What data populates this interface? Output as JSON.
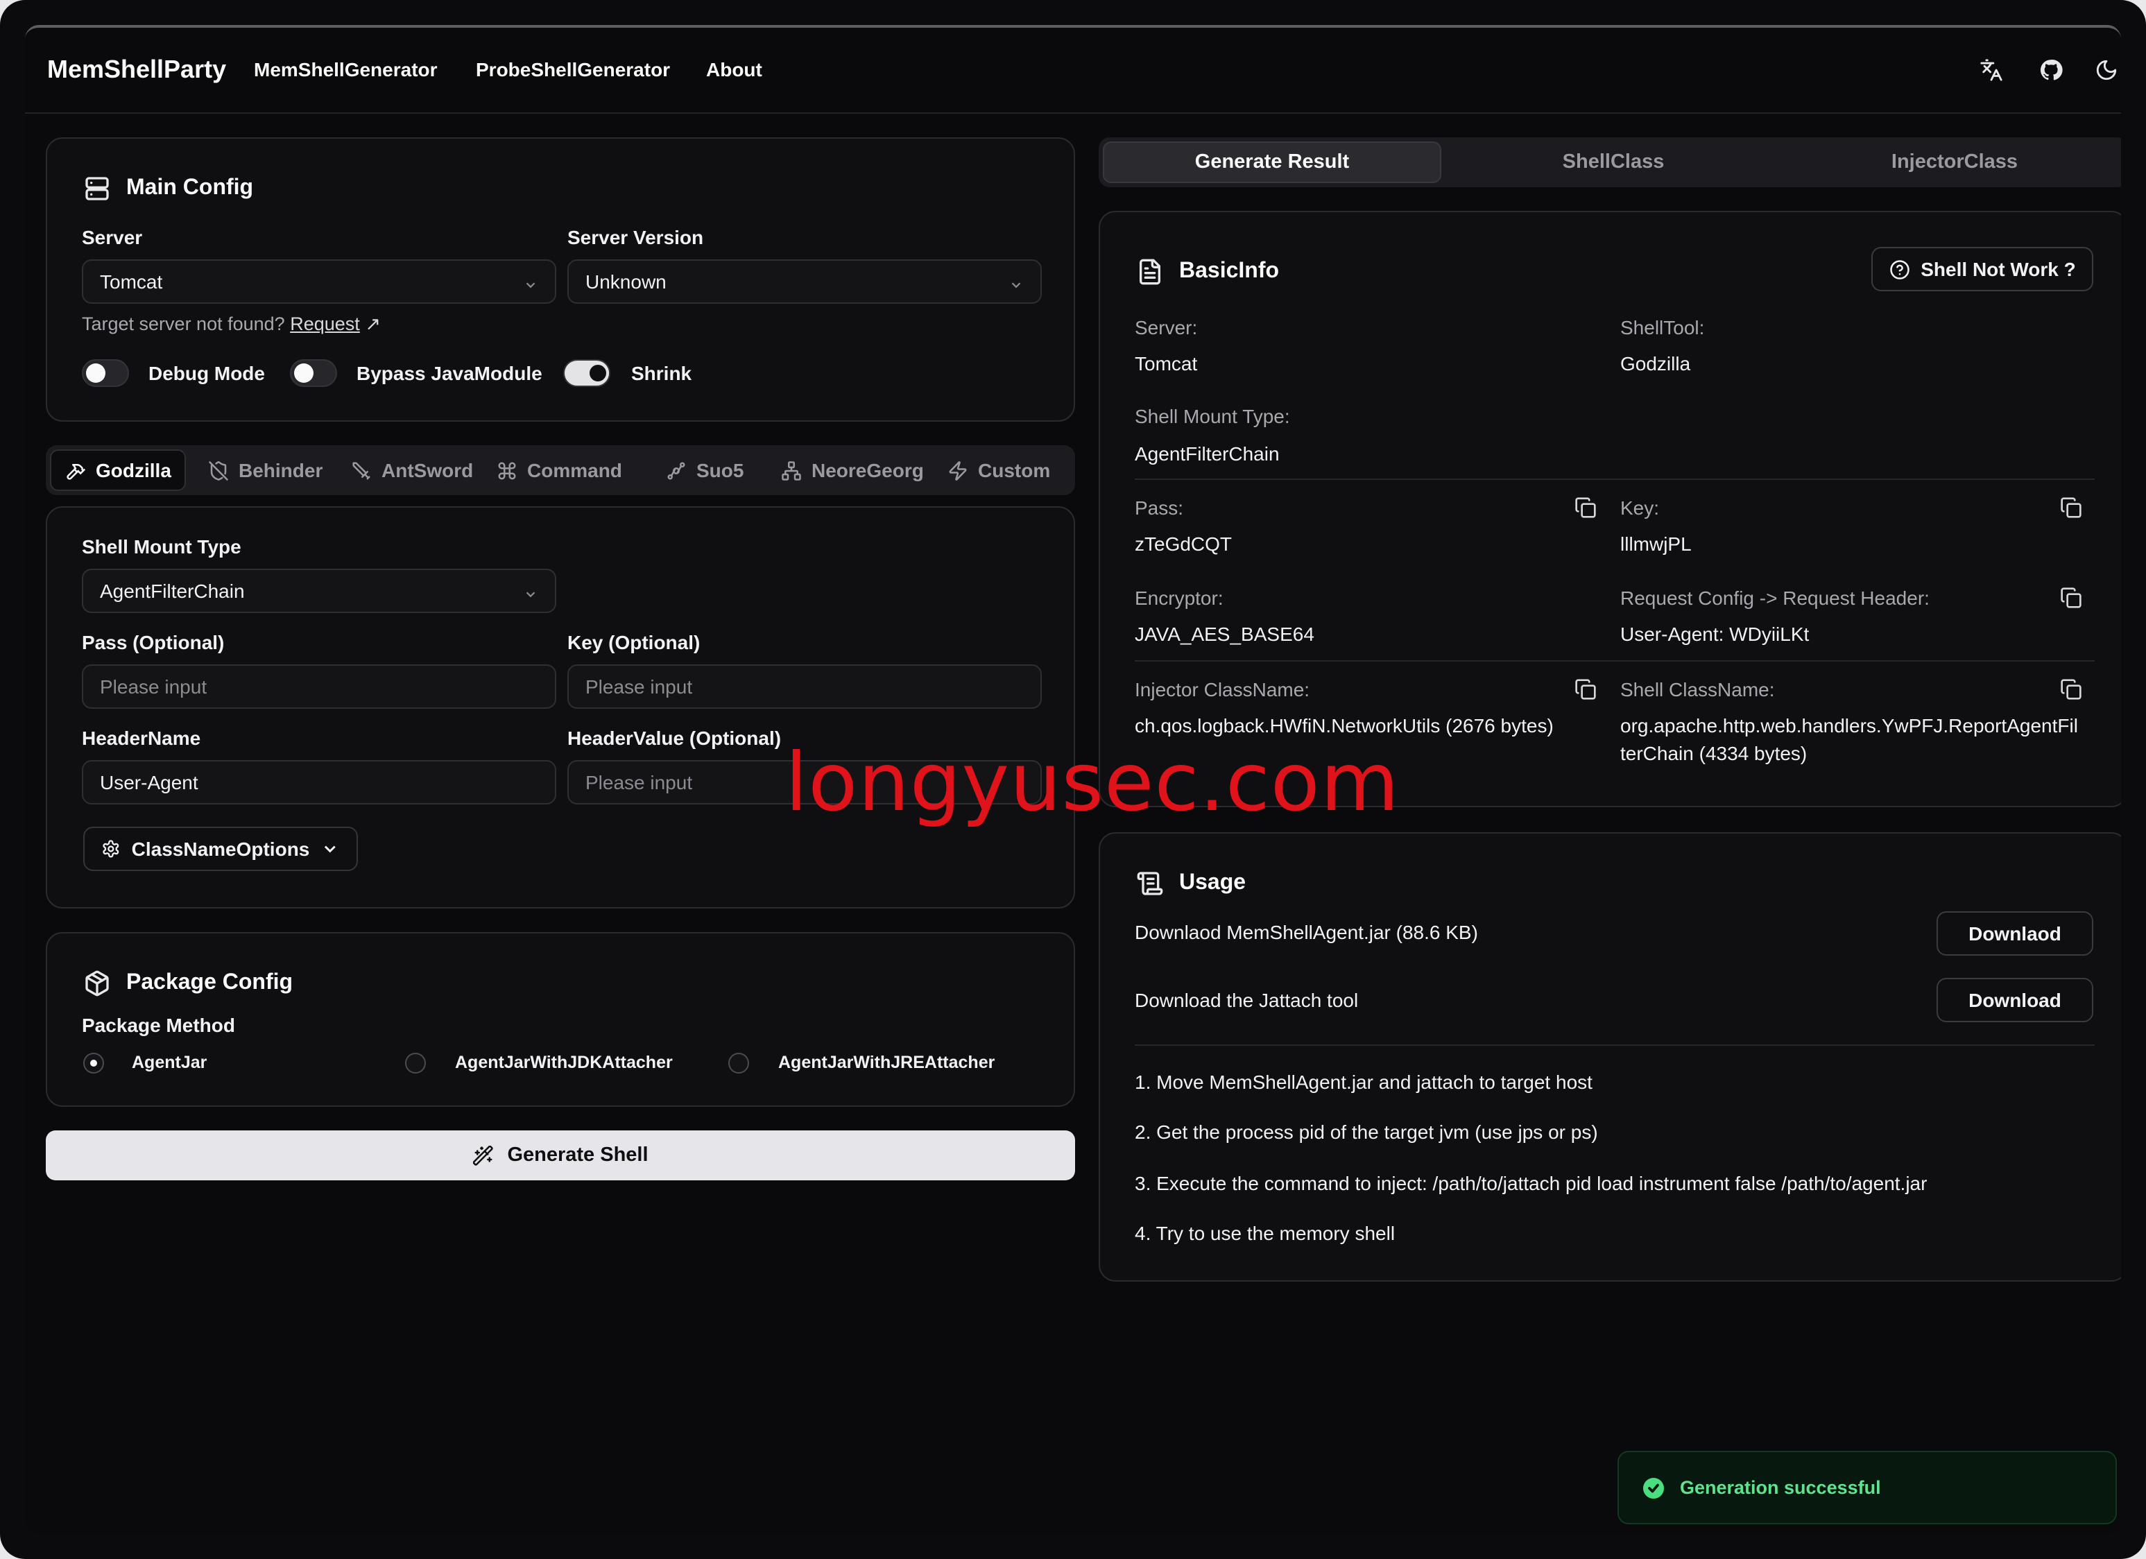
{
  "header": {
    "brand": "MemShellParty",
    "nav": [
      "MemShellGenerator",
      "ProbeShellGenerator",
      "About"
    ],
    "icons": [
      "translate-icon",
      "github-icon",
      "moon-icon"
    ]
  },
  "main_config": {
    "title": "Main Config",
    "server_label": "Server",
    "server_value": "Tomcat",
    "version_label": "Server Version",
    "version_value": "Unknown",
    "hint_text": "Target server not found?",
    "hint_link": "Request",
    "toggles": [
      {
        "label": "Debug Mode",
        "on": false
      },
      {
        "label": "Bypass JavaModule",
        "on": false
      },
      {
        "label": "Shrink",
        "on": true
      }
    ]
  },
  "tools": [
    {
      "label": "Godzilla",
      "active": true
    },
    {
      "label": "Behinder",
      "active": false
    },
    {
      "label": "AntSword",
      "active": false
    },
    {
      "label": "Command",
      "active": false
    },
    {
      "label": "Suo5",
      "active": false
    },
    {
      "label": "NeoreGeorg",
      "active": false
    },
    {
      "label": "Custom",
      "active": false
    }
  ],
  "shell_form": {
    "mount_label": "Shell Mount Type",
    "mount_value": "AgentFilterChain",
    "pass_label": "Pass (Optional)",
    "pass_placeholder": "Please input",
    "key_label": "Key (Optional)",
    "key_placeholder": "Please input",
    "header_name_label": "HeaderName",
    "header_name_value": "User-Agent",
    "header_value_label": "HeaderValue (Optional)",
    "header_value_placeholder": "Please input",
    "classname_btn": "ClassNameOptions"
  },
  "package_config": {
    "title": "Package Config",
    "method_label": "Package Method",
    "options": [
      {
        "label": "AgentJar",
        "selected": true
      },
      {
        "label": "AgentJarWithJDKAttacher",
        "selected": false
      },
      {
        "label": "AgentJarWithJREAttacher",
        "selected": false
      }
    ]
  },
  "generate_btn": "Generate Shell",
  "result_tabs": [
    {
      "label": "Generate Result",
      "active": true
    },
    {
      "label": "ShellClass",
      "active": false
    },
    {
      "label": "InjectorClass",
      "active": false
    }
  ],
  "basic_info": {
    "title": "BasicInfo",
    "help_btn": "Shell Not Work ?",
    "server_key": "Server:",
    "server_val": "Tomcat",
    "tool_key": "ShellTool:",
    "tool_val": "Godzilla",
    "mount_key": "Shell Mount Type:",
    "mount_val": "AgentFilterChain",
    "pass_key": "Pass:",
    "pass_val": "zTeGdCQT",
    "key_key": "Key:",
    "key_val": "lllmwjPL",
    "enc_key": "Encryptor:",
    "enc_val": "JAVA_AES_BASE64",
    "req_key": "Request Config -> Request Header:",
    "req_val": "User-Agent: WDyiiLKt",
    "injector_key": "Injector ClassName:",
    "injector_val": "ch.qos.logback.HWfiN.NetworkUtils (2676 bytes)",
    "shellclass_key": "Shell ClassName:",
    "shellclass_val_line1": "org.apache.http.web.handlers.YwPFJ.ReportAgentFil",
    "shellclass_val_line2": "terChain (4334 bytes)"
  },
  "usage": {
    "title": "Usage",
    "row1_text": "Downlaod MemShellAgent.jar (88.6 KB)",
    "row1_btn": "Downlaod",
    "row2_text": "Download the Jattach tool",
    "row2_btn": "Download",
    "steps": [
      "1. Move MemShellAgent.jar and jattach to target host",
      "2. Get the process pid of the target jvm (use jps or ps)",
      "3. Execute the command to inject: /path/to/jattach pid load instrument false /path/to/agent.jar",
      "4. Try to use the memory shell"
    ]
  },
  "watermark": "longyusec.com",
  "toast": "Generation successful",
  "colors": {
    "background": "#0a0a0c",
    "card": "#0f0f12",
    "accent_success": "#5fe38f",
    "watermark": "#e0121a"
  }
}
